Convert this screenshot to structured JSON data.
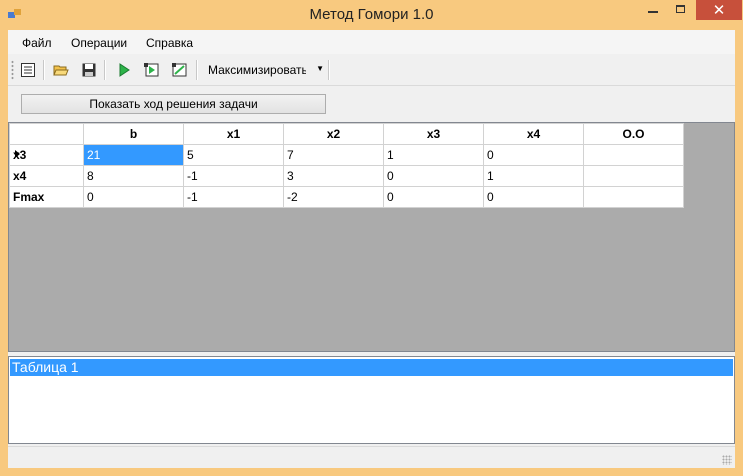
{
  "window": {
    "title": "Метод Гомори 1.0"
  },
  "menu": [
    "Файл",
    "Операции",
    "Справка"
  ],
  "toolbar": {
    "icons": [
      "table-icon",
      "folder-open-icon",
      "save-icon",
      "play-icon",
      "step-icon",
      "report-icon"
    ],
    "mode_selected": "Максимизировать"
  },
  "show_button_label": "Показать ход решения задачи",
  "grid": {
    "columns": [
      "b",
      "x1",
      "x2",
      "x3",
      "x4",
      "O.O"
    ],
    "rows": [
      {
        "header": "x3",
        "cells": [
          "21",
          "5",
          "7",
          "1",
          "0",
          ""
        ]
      },
      {
        "header": "x4",
        "cells": [
          "8",
          "-1",
          "3",
          "0",
          "1",
          ""
        ]
      },
      {
        "header": "Fmax",
        "cells": [
          "0",
          "-1",
          "-2",
          "0",
          "0",
          ""
        ]
      }
    ]
  },
  "list": {
    "items": [
      "Таблица 1"
    ]
  },
  "colors": {
    "title_bar": "#f8c97f",
    "selection": "#3399ff",
    "grid_background": "#ababab",
    "close_button": "#c7503b"
  }
}
